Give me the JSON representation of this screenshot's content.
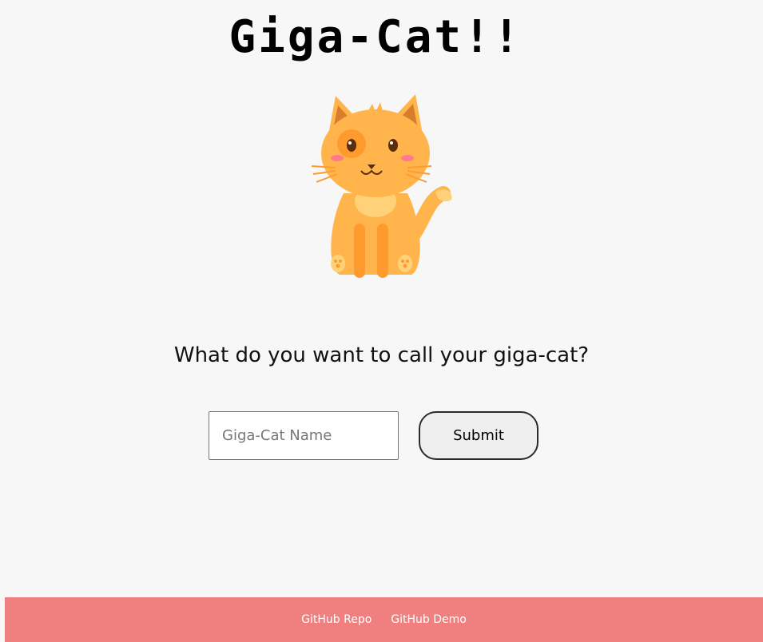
{
  "header": {
    "title": "Giga-Cat!!"
  },
  "hero": {
    "image_icon": "cat-illustration",
    "cat_colors": {
      "body": "#ffb54c",
      "ear_inner": "#d97c2b",
      "belly": "#ffd27a",
      "stripes": "#ff9a2e",
      "cheek": "#ff7a8a"
    }
  },
  "main": {
    "question": "What do you want to call your giga-cat?",
    "name_input": {
      "placeholder": "Giga-Cat Name",
      "value": ""
    },
    "submit_label": "Submit"
  },
  "footer": {
    "background": "#f08080",
    "links": [
      {
        "label": "GitHub Repo"
      },
      {
        "label": "GitHub Demo"
      }
    ]
  }
}
